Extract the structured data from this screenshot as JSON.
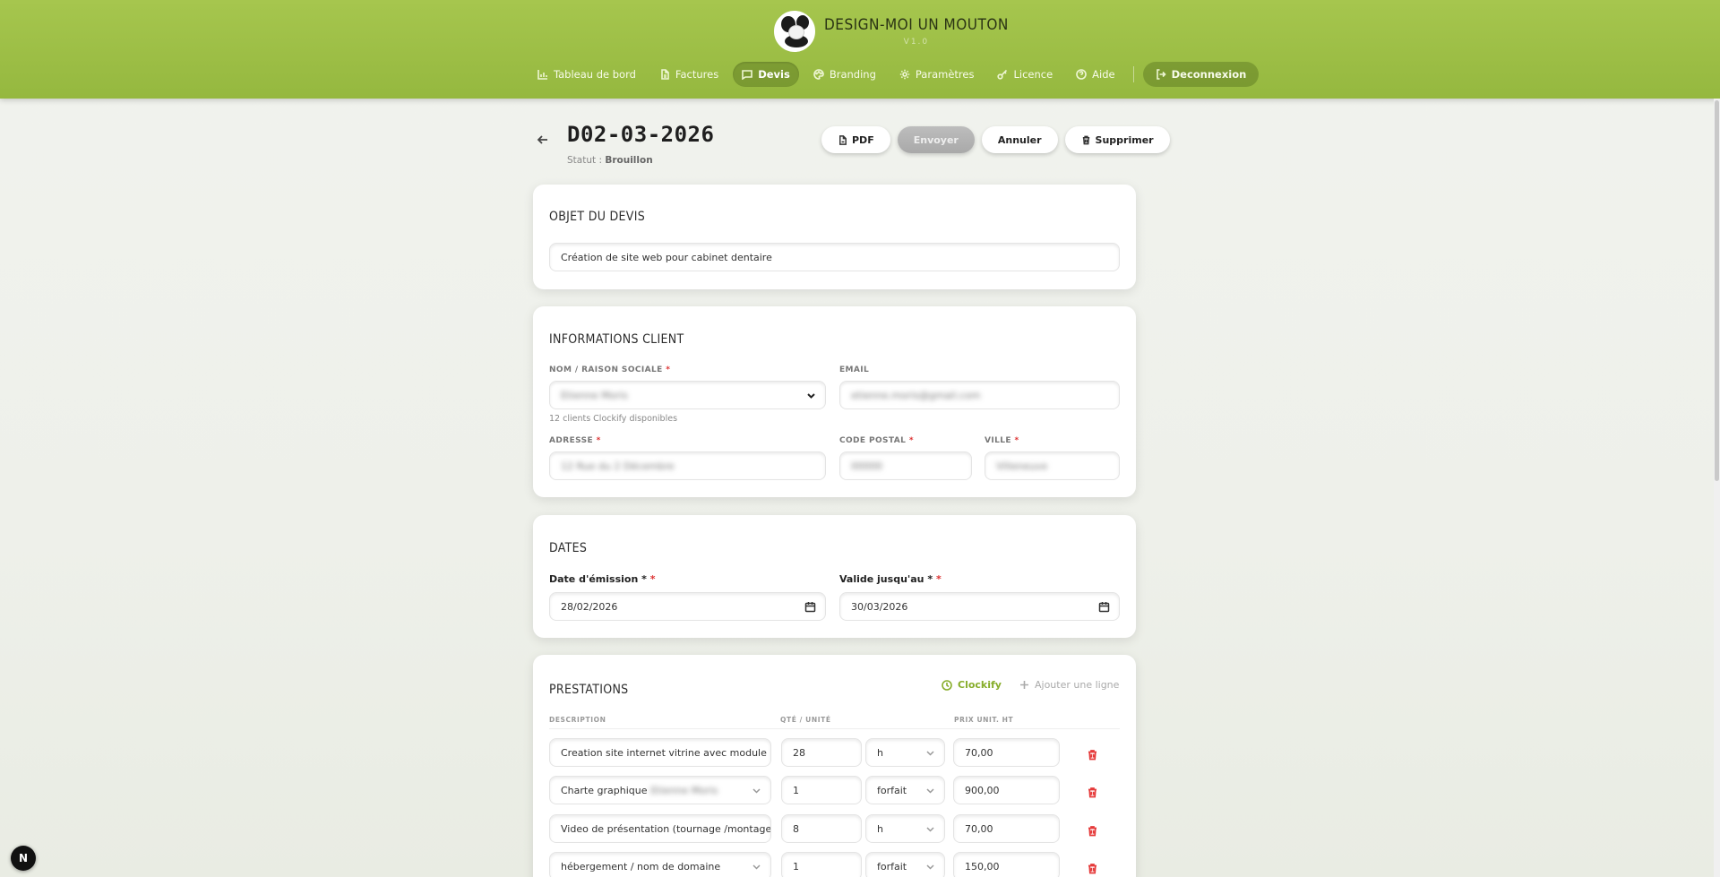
{
  "brand": {
    "name": "DESIGN-MOI UN MOUTON",
    "version": "V1.0"
  },
  "nav": {
    "items": [
      {
        "label": "Tableau de bord",
        "icon": "chart-icon"
      },
      {
        "label": "Factures",
        "icon": "file-icon"
      },
      {
        "label": "Devis",
        "icon": "message-icon"
      },
      {
        "label": "Branding",
        "icon": "palette-icon"
      },
      {
        "label": "Paramètres",
        "icon": "gear-icon"
      },
      {
        "label": "Licence",
        "icon": "key-icon"
      },
      {
        "label": "Aide",
        "icon": "help-circle-icon"
      }
    ],
    "active": "Devis",
    "logout_label": "Deconnexion"
  },
  "document": {
    "number": "D02-03-2026",
    "status_label": "Statut :",
    "status_value": "Brouillon"
  },
  "actions": {
    "pdf": "PDF",
    "send": "Envoyer",
    "cancel": "Annuler",
    "delete": "Supprimer"
  },
  "objet": {
    "title": "OBJET DU DEVIS",
    "value": "Création de site web pour cabinet dentaire"
  },
  "client": {
    "title": "INFORMATIONS CLIENT",
    "name_label": "NOM / RAISON SOCIALE",
    "name_value": "Etienne Moris",
    "name_hint": "12 clients Clockify disponibles",
    "email_label": "EMAIL",
    "email_value": "etienne.moris@gmail.com",
    "address_label": "ADRESSE",
    "address_value": "12 Rue du 2 Décembre",
    "postal_label": "CODE POSTAL",
    "postal_value": "00000",
    "city_label": "VILLE",
    "city_value": "Villeneuve"
  },
  "dates": {
    "title": "DATES",
    "issue_label": "Date d'émission *",
    "issue_value": "28/02/2026",
    "valid_label": "Valide jusqu'au *",
    "valid_value": "30/03/2026"
  },
  "prestations": {
    "title": "PRESTATIONS",
    "clockify_label": "Clockify",
    "add_line_label": "Ajouter une ligne",
    "columns": {
      "description": "DESCRIPTION",
      "qty_unit": "QTÉ / UNITÉ",
      "unit_price": "PRIX UNIT. HT"
    },
    "rows": [
      {
        "description": "Creation site internet vitrine avec module de m",
        "qty": "28",
        "unit": "h",
        "price": "70,00",
        "blurred_suffix": ""
      },
      {
        "description": "Charte graphique ",
        "qty": "1",
        "unit": "forfait",
        "price": "900,00",
        "blurred_suffix": "Etienne Moris"
      },
      {
        "description": "Video de présentation (tournage /montage/éta",
        "qty": "8",
        "unit": "h",
        "price": "70,00",
        "blurred_suffix": ""
      },
      {
        "description": "hébergement / nom de domaine",
        "qty": "1",
        "unit": "forfait",
        "price": "150,00",
        "blurred_suffix": ""
      }
    ]
  },
  "dev_badge": "N"
}
